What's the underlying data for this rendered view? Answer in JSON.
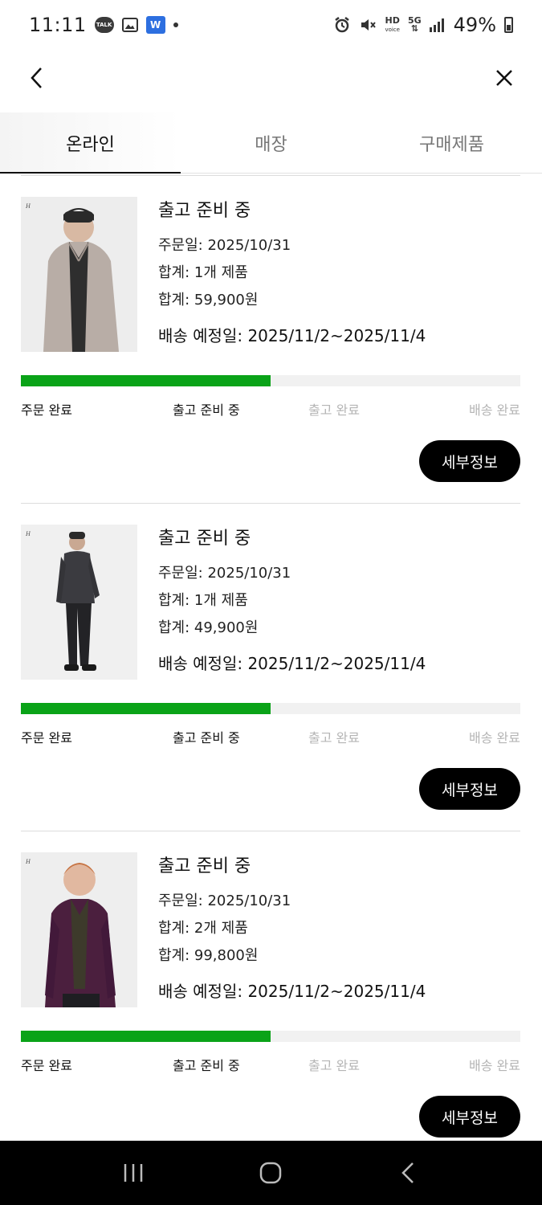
{
  "status_bar": {
    "time": "11:11",
    "talk_label": "TALK",
    "app_badge_label": "W",
    "hd_label": "HD",
    "voice_label": "voice",
    "network_label": "5G",
    "battery_percent": "49%",
    "battery_level": 0.49
  },
  "tabs": [
    {
      "label": "온라인",
      "active": true
    },
    {
      "label": "매장",
      "active": false
    },
    {
      "label": "구매제품",
      "active": false
    }
  ],
  "orders": [
    {
      "status": "출고 준비 중",
      "order_date": "주문일: 2025/10/31",
      "item_count": "합계: 1개 제품",
      "total": "합계: 59,900원",
      "eta": "배송 예정일: 2025/11/2~2025/11/4",
      "product_image": "beige-fleece-jacket-model",
      "progress": 0.5,
      "steps": [
        "주문 완료",
        "출고 준비 중",
        "출고 완료",
        "배송 완료"
      ],
      "detail_label": "세부정보"
    },
    {
      "status": "출고 준비 중",
      "order_date": "주문일: 2025/10/31",
      "item_count": "합계: 1개 제품",
      "total": "합계: 49,900원",
      "eta": "배송 예정일: 2025/11/2~2025/11/4",
      "product_image": "dark-blazer-full-body-model",
      "progress": 0.5,
      "steps": [
        "주문 완료",
        "출고 준비 중",
        "출고 완료",
        "배송 완료"
      ],
      "detail_label": "세부정보"
    },
    {
      "status": "출고 준비 중",
      "order_date": "주문일: 2025/10/31",
      "item_count": "합계: 2개 제품",
      "total": "합계: 99,800원",
      "eta": "배송 예정일: 2025/11/2~2025/11/4",
      "product_image": "purple-cardigan-model",
      "progress": 0.5,
      "steps": [
        "주문 완료",
        "출고 준비 중",
        "출고 완료",
        "배송 완료"
      ],
      "detail_label": "세부정보"
    }
  ],
  "colors": {
    "progress_fill": "#0aa318",
    "progress_track": "#f1f1f1",
    "step_done": "#111111",
    "step_todo": "#b5b5b5"
  }
}
